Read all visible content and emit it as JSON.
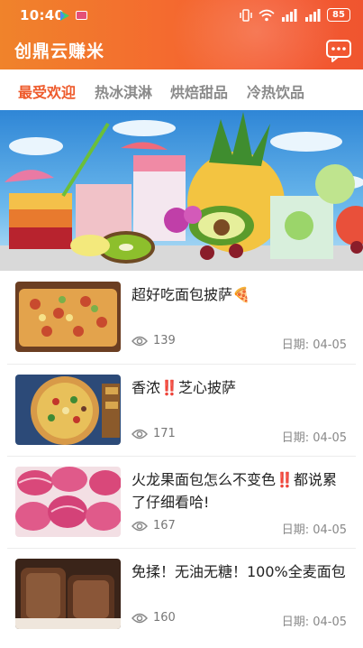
{
  "status_bar": {
    "time": "10:40",
    "battery": "85"
  },
  "app_bar": {
    "title": "创鼎云赚米"
  },
  "tabs": [
    {
      "label": "最受欢迎",
      "active": true
    },
    {
      "label": "热冰淇淋",
      "active": false
    },
    {
      "label": "烘焙甜品",
      "active": false
    },
    {
      "label": "冷热饮品",
      "active": false
    }
  ],
  "colors": {
    "accent": "#ee5a2b",
    "header": "#f46b2f"
  },
  "items": [
    {
      "title": "超好吃面包披萨🍕",
      "views": "139",
      "date": "日期: 04-05"
    },
    {
      "title_a": "香浓",
      "title_b": "‼️",
      "title_c": "芝心披萨",
      "views": "171",
      "date": "日期: 04-05"
    },
    {
      "title_a": "火龙果面包怎么不变色",
      "title_b": "‼️",
      "title_c": "都说累了仔细看哈!",
      "views": "167",
      "date": "日期: 04-05"
    },
    {
      "title": "免揉！无油无糖！100%全麦面包",
      "views": "160",
      "date": "日期: 04-05"
    }
  ]
}
